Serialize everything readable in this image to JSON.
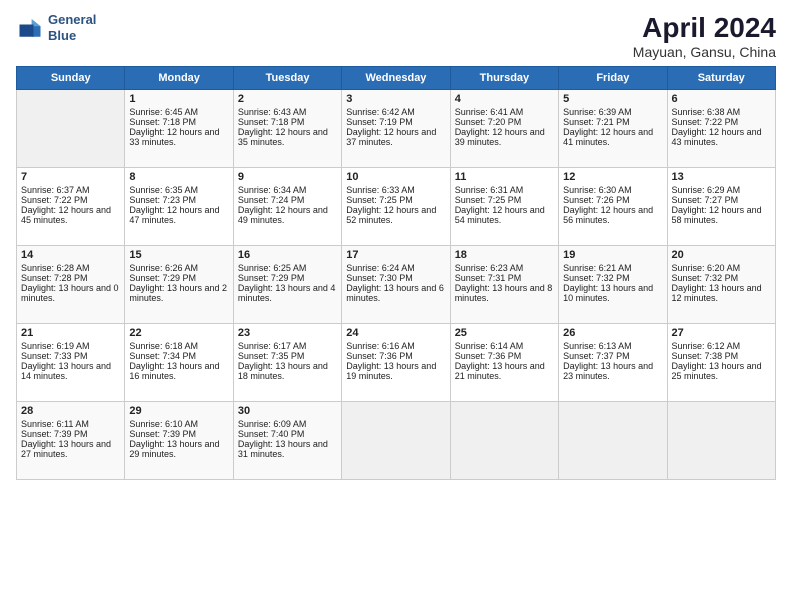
{
  "header": {
    "logo_line1": "General",
    "logo_line2": "Blue",
    "title": "April 2024",
    "subtitle": "Mayuan, Gansu, China"
  },
  "days_of_week": [
    "Sunday",
    "Monday",
    "Tuesday",
    "Wednesday",
    "Thursday",
    "Friday",
    "Saturday"
  ],
  "weeks": [
    [
      {
        "day": null
      },
      {
        "day": 1,
        "sunrise": "Sunrise: 6:45 AM",
        "sunset": "Sunset: 7:18 PM",
        "daylight": "Daylight: 12 hours and 33 minutes."
      },
      {
        "day": 2,
        "sunrise": "Sunrise: 6:43 AM",
        "sunset": "Sunset: 7:18 PM",
        "daylight": "Daylight: 12 hours and 35 minutes."
      },
      {
        "day": 3,
        "sunrise": "Sunrise: 6:42 AM",
        "sunset": "Sunset: 7:19 PM",
        "daylight": "Daylight: 12 hours and 37 minutes."
      },
      {
        "day": 4,
        "sunrise": "Sunrise: 6:41 AM",
        "sunset": "Sunset: 7:20 PM",
        "daylight": "Daylight: 12 hours and 39 minutes."
      },
      {
        "day": 5,
        "sunrise": "Sunrise: 6:39 AM",
        "sunset": "Sunset: 7:21 PM",
        "daylight": "Daylight: 12 hours and 41 minutes."
      },
      {
        "day": 6,
        "sunrise": "Sunrise: 6:38 AM",
        "sunset": "Sunset: 7:22 PM",
        "daylight": "Daylight: 12 hours and 43 minutes."
      }
    ],
    [
      {
        "day": 7,
        "sunrise": "Sunrise: 6:37 AM",
        "sunset": "Sunset: 7:22 PM",
        "daylight": "Daylight: 12 hours and 45 minutes."
      },
      {
        "day": 8,
        "sunrise": "Sunrise: 6:35 AM",
        "sunset": "Sunset: 7:23 PM",
        "daylight": "Daylight: 12 hours and 47 minutes."
      },
      {
        "day": 9,
        "sunrise": "Sunrise: 6:34 AM",
        "sunset": "Sunset: 7:24 PM",
        "daylight": "Daylight: 12 hours and 49 minutes."
      },
      {
        "day": 10,
        "sunrise": "Sunrise: 6:33 AM",
        "sunset": "Sunset: 7:25 PM",
        "daylight": "Daylight: 12 hours and 52 minutes."
      },
      {
        "day": 11,
        "sunrise": "Sunrise: 6:31 AM",
        "sunset": "Sunset: 7:25 PM",
        "daylight": "Daylight: 12 hours and 54 minutes."
      },
      {
        "day": 12,
        "sunrise": "Sunrise: 6:30 AM",
        "sunset": "Sunset: 7:26 PM",
        "daylight": "Daylight: 12 hours and 56 minutes."
      },
      {
        "day": 13,
        "sunrise": "Sunrise: 6:29 AM",
        "sunset": "Sunset: 7:27 PM",
        "daylight": "Daylight: 12 hours and 58 minutes."
      }
    ],
    [
      {
        "day": 14,
        "sunrise": "Sunrise: 6:28 AM",
        "sunset": "Sunset: 7:28 PM",
        "daylight": "Daylight: 13 hours and 0 minutes."
      },
      {
        "day": 15,
        "sunrise": "Sunrise: 6:26 AM",
        "sunset": "Sunset: 7:29 PM",
        "daylight": "Daylight: 13 hours and 2 minutes."
      },
      {
        "day": 16,
        "sunrise": "Sunrise: 6:25 AM",
        "sunset": "Sunset: 7:29 PM",
        "daylight": "Daylight: 13 hours and 4 minutes."
      },
      {
        "day": 17,
        "sunrise": "Sunrise: 6:24 AM",
        "sunset": "Sunset: 7:30 PM",
        "daylight": "Daylight: 13 hours and 6 minutes."
      },
      {
        "day": 18,
        "sunrise": "Sunrise: 6:23 AM",
        "sunset": "Sunset: 7:31 PM",
        "daylight": "Daylight: 13 hours and 8 minutes."
      },
      {
        "day": 19,
        "sunrise": "Sunrise: 6:21 AM",
        "sunset": "Sunset: 7:32 PM",
        "daylight": "Daylight: 13 hours and 10 minutes."
      },
      {
        "day": 20,
        "sunrise": "Sunrise: 6:20 AM",
        "sunset": "Sunset: 7:32 PM",
        "daylight": "Daylight: 13 hours and 12 minutes."
      }
    ],
    [
      {
        "day": 21,
        "sunrise": "Sunrise: 6:19 AM",
        "sunset": "Sunset: 7:33 PM",
        "daylight": "Daylight: 13 hours and 14 minutes."
      },
      {
        "day": 22,
        "sunrise": "Sunrise: 6:18 AM",
        "sunset": "Sunset: 7:34 PM",
        "daylight": "Daylight: 13 hours and 16 minutes."
      },
      {
        "day": 23,
        "sunrise": "Sunrise: 6:17 AM",
        "sunset": "Sunset: 7:35 PM",
        "daylight": "Daylight: 13 hours and 18 minutes."
      },
      {
        "day": 24,
        "sunrise": "Sunrise: 6:16 AM",
        "sunset": "Sunset: 7:36 PM",
        "daylight": "Daylight: 13 hours and 19 minutes."
      },
      {
        "day": 25,
        "sunrise": "Sunrise: 6:14 AM",
        "sunset": "Sunset: 7:36 PM",
        "daylight": "Daylight: 13 hours and 21 minutes."
      },
      {
        "day": 26,
        "sunrise": "Sunrise: 6:13 AM",
        "sunset": "Sunset: 7:37 PM",
        "daylight": "Daylight: 13 hours and 23 minutes."
      },
      {
        "day": 27,
        "sunrise": "Sunrise: 6:12 AM",
        "sunset": "Sunset: 7:38 PM",
        "daylight": "Daylight: 13 hours and 25 minutes."
      }
    ],
    [
      {
        "day": 28,
        "sunrise": "Sunrise: 6:11 AM",
        "sunset": "Sunset: 7:39 PM",
        "daylight": "Daylight: 13 hours and 27 minutes."
      },
      {
        "day": 29,
        "sunrise": "Sunrise: 6:10 AM",
        "sunset": "Sunset: 7:39 PM",
        "daylight": "Daylight: 13 hours and 29 minutes."
      },
      {
        "day": 30,
        "sunrise": "Sunrise: 6:09 AM",
        "sunset": "Sunset: 7:40 PM",
        "daylight": "Daylight: 13 hours and 31 minutes."
      },
      {
        "day": null
      },
      {
        "day": null
      },
      {
        "day": null
      },
      {
        "day": null
      }
    ]
  ]
}
